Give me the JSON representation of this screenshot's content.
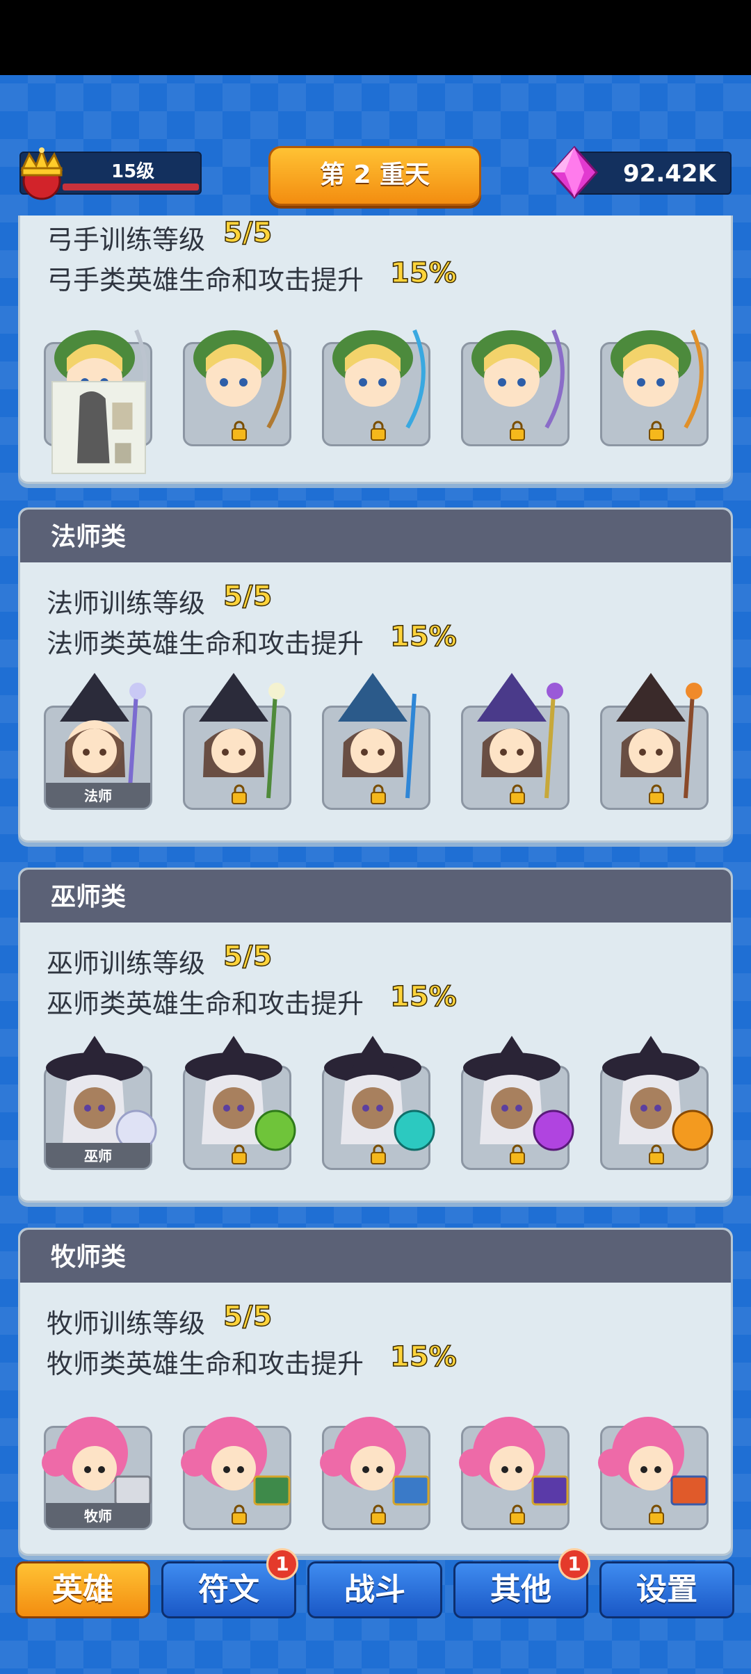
{
  "hud": {
    "level": "15级",
    "stage": "第 2 重天",
    "gems": "92.42K"
  },
  "colors": {
    "accent_orange": "#f38d10",
    "panel_header": "#5b6176",
    "highlight_yellow": "#ffd43b",
    "nav_blue": "#1a58c6"
  },
  "sections": [
    {
      "title": "",
      "level_label": "弓手训练等级",
      "level_value": "5/5",
      "boost_label": "弓手类英雄生命和攻击提升",
      "boost_value": "15%",
      "heroes": [
        {
          "label": "",
          "locked": false
        },
        {
          "label": "",
          "locked": true
        },
        {
          "label": "",
          "locked": true
        },
        {
          "label": "",
          "locked": true
        },
        {
          "label": "",
          "locked": true
        }
      ]
    },
    {
      "title": "法师类",
      "level_label": "法师训练等级",
      "level_value": "5/5",
      "boost_label": "法师类英雄生命和攻击提升",
      "boost_value": "15%",
      "heroes": [
        {
          "label": "法师",
          "locked": false
        },
        {
          "label": "",
          "locked": true
        },
        {
          "label": "",
          "locked": true
        },
        {
          "label": "",
          "locked": true
        },
        {
          "label": "",
          "locked": true
        }
      ]
    },
    {
      "title": "巫师类",
      "level_label": "巫师训练等级",
      "level_value": "5/5",
      "boost_label": "巫师类英雄生命和攻击提升",
      "boost_value": "15%",
      "heroes": [
        {
          "label": "巫师",
          "locked": false
        },
        {
          "label": "",
          "locked": true
        },
        {
          "label": "",
          "locked": true
        },
        {
          "label": "",
          "locked": true
        },
        {
          "label": "",
          "locked": true
        }
      ]
    },
    {
      "title": "牧师类",
      "level_label": "牧师训练等级",
      "level_value": "5/5",
      "boost_label": "牧师类英雄生命和攻击提升",
      "boost_value": "15%",
      "heroes": [
        {
          "label": "牧师",
          "locked": false
        },
        {
          "label": "",
          "locked": true
        },
        {
          "label": "",
          "locked": true
        },
        {
          "label": "",
          "locked": true
        },
        {
          "label": "",
          "locked": true
        }
      ]
    }
  ],
  "nav": {
    "heroes": "英雄",
    "runes": "符文",
    "runes_badge": "1",
    "battle": "战斗",
    "other": "其他",
    "other_badge": "1",
    "settings": "设置"
  }
}
